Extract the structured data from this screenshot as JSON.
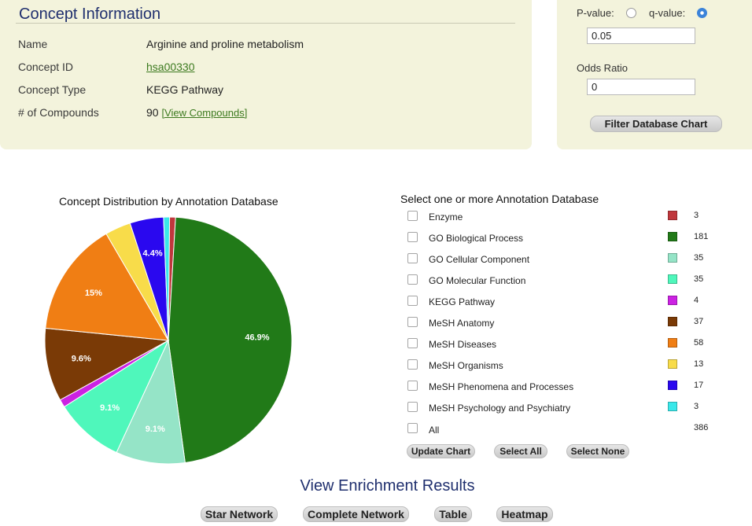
{
  "concept": {
    "title": "Concept Information",
    "rows": [
      {
        "label": "Name",
        "value": "Arginine and proline metabolism"
      },
      {
        "label": "Concept ID",
        "value": "hsa00330"
      },
      {
        "label": "Concept Type",
        "value": "KEGG Pathway"
      },
      {
        "label": "# of Compounds",
        "value": "90",
        "link": "[View Compounds]"
      }
    ]
  },
  "filter": {
    "pvalue_label": "P-value:",
    "qvalue_label": "q-value:",
    "selected": "q-value",
    "threshold_value": "0.05",
    "odds_label": "Odds Ratio",
    "odds_value": "0",
    "button": "Filter Database Chart"
  },
  "chart_data": {
    "type": "pie",
    "title": "Concept Distribution by Annotation Database",
    "slices": [
      {
        "label": "Enzyme",
        "value": 3,
        "color": "#c0373c",
        "display": ""
      },
      {
        "label": "GO Biological Process",
        "value": 181,
        "color": "#217a18",
        "display": "46.9%"
      },
      {
        "label": "GO Cellular Component",
        "value": 35,
        "color": "#95e4c7",
        "display": "9.1%"
      },
      {
        "label": "GO Molecular Function",
        "value": 35,
        "color": "#4ff7bb",
        "display": "9.1%"
      },
      {
        "label": "KEGG Pathway",
        "value": 4,
        "color": "#cc22e3",
        "display": ""
      },
      {
        "label": "MeSH Anatomy",
        "value": 37,
        "color": "#7a3a06",
        "display": "9.6%"
      },
      {
        "label": "MeSH Diseases",
        "value": 58,
        "color": "#f07e14",
        "display": "15%"
      },
      {
        "label": "MeSH Organisms",
        "value": 13,
        "color": "#f8dc4a",
        "display": ""
      },
      {
        "label": "MeSH Phenomena and Processes",
        "value": 17,
        "color": "#2a08ef",
        "display": "4.4%"
      },
      {
        "label": "MeSH Psychology and Psychiatry",
        "value": 3,
        "color": "#3ae8ea",
        "display": ""
      }
    ]
  },
  "db_list": {
    "title": "Select one or more Annotation Database",
    "all_label": "All",
    "all_count": "386",
    "buttons": {
      "update": "Update Chart",
      "select_all": "Select All",
      "select_none": "Select None"
    }
  },
  "enrichment": {
    "title": "View Enrichment Results",
    "buttons": {
      "star": "Star Network",
      "complete": "Complete Network",
      "table": "Table",
      "heatmap": "Heatmap"
    }
  }
}
